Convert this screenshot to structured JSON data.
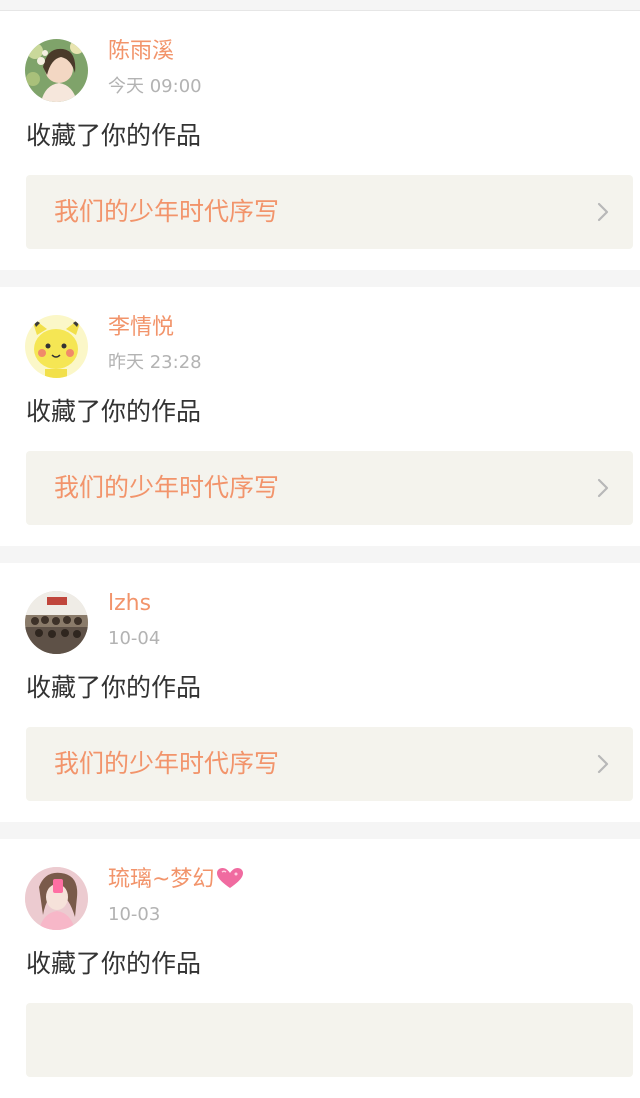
{
  "notifications": [
    {
      "username": "陈雨溪",
      "time": "今天  09:00",
      "action": "收藏了你的作品",
      "work_title": "我们的少年时代序写",
      "avatar": "woman-flowers-avatar"
    },
    {
      "username": "李情悦",
      "time": "昨天  23:28",
      "action": "收藏了你的作品",
      "work_title": "我们的少年时代序写",
      "avatar": "cartoon-pikachu-avatar"
    },
    {
      "username": "lzhs",
      "time": "10-04",
      "action": "收藏了你的作品",
      "work_title": "我们的少年时代序写",
      "avatar": "group-photo-avatar"
    },
    {
      "username": "琉璃~梦幻",
      "time": "10-03",
      "action": "收藏了你的作品",
      "work_title": "",
      "avatar": "girl-pink-avatar"
    }
  ],
  "colors": {
    "accent": "#f2946b",
    "time_gray": "#b3b3b3",
    "text_dark": "#333333",
    "box_bg": "#f4f3ed",
    "heart_pink": "#f06ba0"
  }
}
